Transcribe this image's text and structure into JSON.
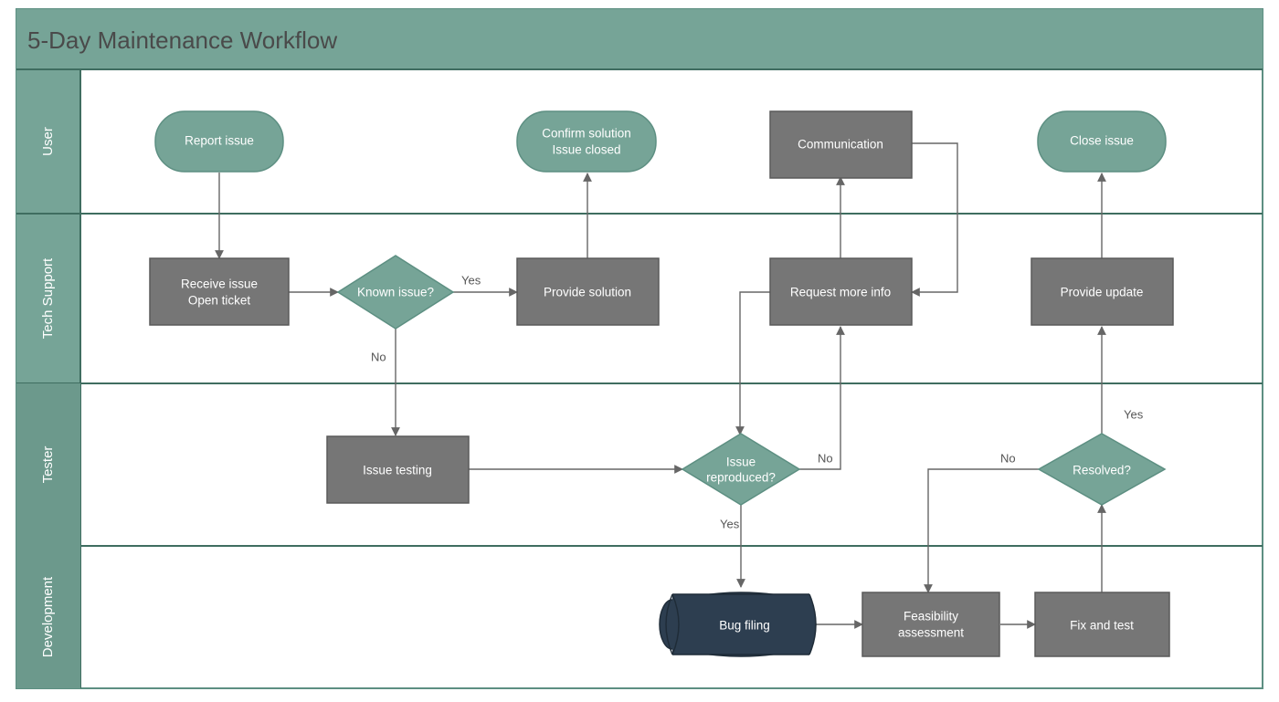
{
  "title": "5-Day Maintenance Workflow",
  "lanes": [
    {
      "id": "user",
      "label": "User"
    },
    {
      "id": "support",
      "label": "Tech Support"
    },
    {
      "id": "tester",
      "label": "Tester"
    },
    {
      "id": "dev",
      "label": "Development"
    }
  ],
  "nodes": {
    "report": {
      "line1": "Report issue"
    },
    "confirm": {
      "line1": "Confirm solution",
      "line2": "Issue closed"
    },
    "comm": {
      "line1": "Communication"
    },
    "close": {
      "line1": "Close issue"
    },
    "receive": {
      "line1": "Receive issue",
      "line2": "Open ticket"
    },
    "known": {
      "line1": "Known issue?"
    },
    "solution": {
      "line1": "Provide solution"
    },
    "reqinfo": {
      "line1": "Request more info"
    },
    "update": {
      "line1": "Provide update"
    },
    "testing": {
      "line1": "Issue testing"
    },
    "reproduced": {
      "line1": "Issue",
      "line2": "reproduced?"
    },
    "resolved": {
      "line1": "Resolved?"
    },
    "bug": {
      "line1": "Bug filing"
    },
    "feas": {
      "line1": "Feasibility",
      "line2": "assessment"
    },
    "fix": {
      "line1": "Fix and test"
    }
  },
  "edges": {
    "known_yes": "Yes",
    "known_no": "No",
    "reproduced_yes": "Yes",
    "reproduced_no": "No",
    "resolved_yes": "Yes",
    "resolved_no": "No"
  },
  "colors": {
    "title_bar": "#76a497",
    "lane_bar": "#76a497",
    "lane_bar_bottom": "#6c998c",
    "teal": "#76a497",
    "gray": "#767676",
    "dark_blue": "#2d3e50",
    "border": "#5d8f82",
    "grid": "#5d8f82",
    "connector": "#666666"
  }
}
